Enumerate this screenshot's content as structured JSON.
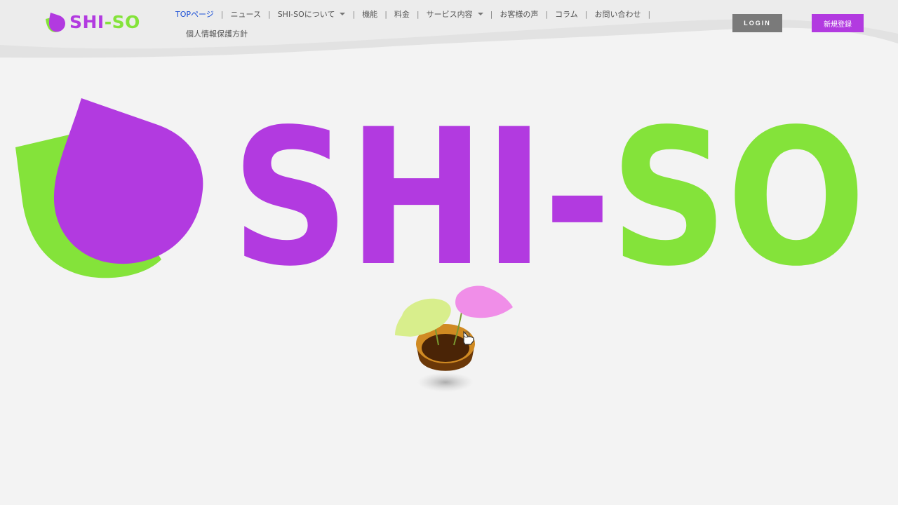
{
  "brand": {
    "logo_part1": "SHI",
    "logo_part2": "-SO",
    "hero_part1": "SHI-",
    "hero_part2": "SO",
    "purple": "#b23ae0",
    "green": "#84e33a"
  },
  "nav": {
    "items": [
      {
        "label": "TOPページ",
        "active": true
      },
      {
        "label": "ニュース"
      },
      {
        "label": "SHI-SOについて",
        "has_dropdown": true
      },
      {
        "label": "機能"
      },
      {
        "label": "料金"
      },
      {
        "label": "サービス内容",
        "has_dropdown": true
      },
      {
        "label": "お客様の声"
      },
      {
        "label": "コラム"
      },
      {
        "label": "お問い合わせ"
      },
      {
        "label": "個人情報保護方針"
      }
    ],
    "separator": "|",
    "active_color": "#1a4fd6"
  },
  "buttons": {
    "login": "LOGIN",
    "signup": "新規登録"
  },
  "icons": {
    "logo_mark": "shiso-leaf-logo-icon",
    "hero_mark": "shiso-leaf-large-icon",
    "plant": "potted-plant-icon",
    "cursor": "hand-pointer-icon"
  }
}
